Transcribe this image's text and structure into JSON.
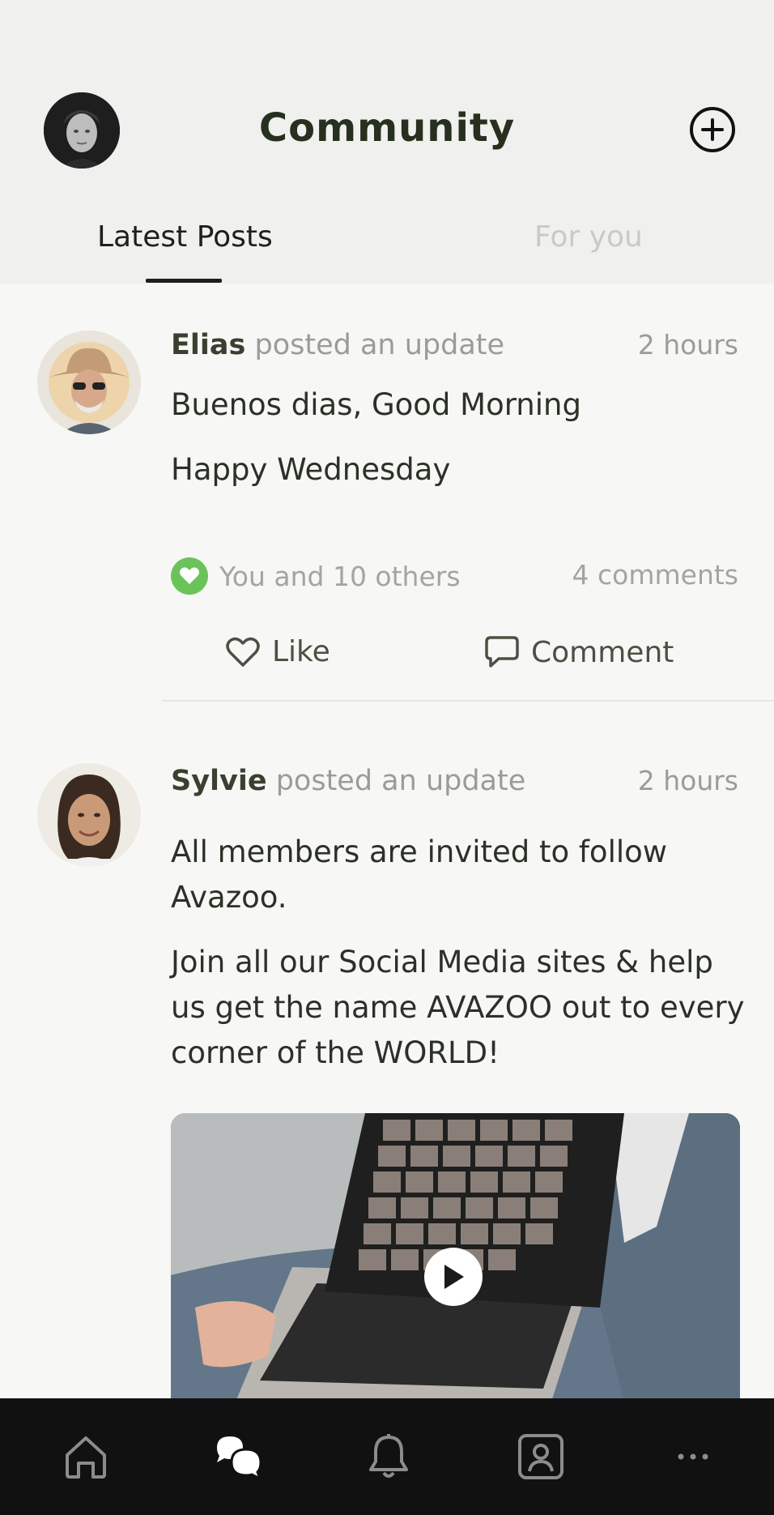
{
  "header": {
    "title": "Community",
    "tabs": [
      {
        "label": "Latest Posts",
        "active": true
      },
      {
        "label": "For you",
        "active": false
      }
    ]
  },
  "colors": {
    "accent_green": "#6ac359",
    "dark_text": "#27301f",
    "muted_text": "#9b9b98",
    "nav_bg": "#111111"
  },
  "posts": [
    {
      "author": "Elias",
      "action": "posted an update",
      "time": "2 hours",
      "paragraphs": [
        "Buenos dias, Good Morning",
        "Happy Wednesday"
      ],
      "likes_text": "You and 10 others",
      "comments_text": "4 comments",
      "like_label": "Like",
      "comment_label": "Comment"
    },
    {
      "author": "Sylvie",
      "action": "posted an update",
      "time": "2 hours",
      "paragraphs": [
        "All members are invited to follow Avazoo.",
        "Join all our Social Media sites & help us get the name AVAZOO out to every corner of the WORLD!"
      ],
      "media_type": "video"
    }
  ],
  "bottom_nav": [
    {
      "icon": "home-icon",
      "active": false
    },
    {
      "icon": "chat-bubbles-icon",
      "active": true
    },
    {
      "icon": "bell-icon",
      "active": false
    },
    {
      "icon": "profile-icon",
      "active": false
    },
    {
      "icon": "more-icon",
      "active": false
    }
  ]
}
